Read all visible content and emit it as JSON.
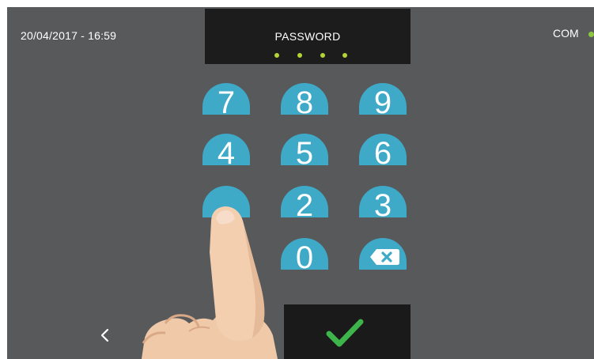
{
  "status": {
    "datetime": "20/04/2017 - 16:59",
    "com_label": "COM",
    "com_color": "#8dc63f"
  },
  "password": {
    "label": "PASSWORD",
    "entered_digits": 4,
    "dot_color": "#b4d334"
  },
  "keypad": {
    "key_color": "#3fa9c8",
    "keys": [
      {
        "label": "7"
      },
      {
        "label": "8"
      },
      {
        "label": "9"
      },
      {
        "label": "4"
      },
      {
        "label": "5"
      },
      {
        "label": "6"
      },
      {
        "label": ""
      },
      {
        "label": "2"
      },
      {
        "label": "3"
      },
      {
        "label": "0"
      },
      {
        "icon": "backspace-icon"
      }
    ]
  },
  "actions": {
    "back_icon": "chevron-left-icon",
    "confirm_icon": "checkmark-icon",
    "confirm_color": "#3db54a"
  },
  "overlay": {
    "icon": "pointing-finger"
  }
}
